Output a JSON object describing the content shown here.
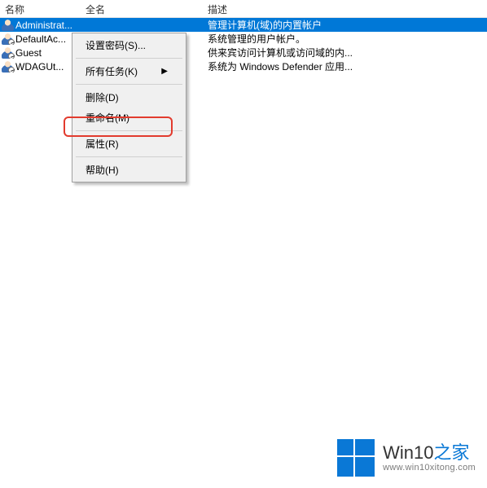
{
  "columns": {
    "name": "名称",
    "full": "全名",
    "desc": "描述"
  },
  "rows": [
    {
      "name": "Administrat...",
      "desc": "管理计算机(域)的内置帐户",
      "selected": true,
      "active": true
    },
    {
      "name": "DefaultAc...",
      "desc": "系统管理的用户帐户。"
    },
    {
      "name": "Guest",
      "desc": "供来宾访问计算机或访问域的内..."
    },
    {
      "name": "WDAGUt...",
      "desc": "系统为 Windows Defender 应用..."
    }
  ],
  "menu": {
    "set_password": "设置密码(S)...",
    "all_tasks": "所有任务(K)",
    "delete": "删除(D)",
    "rename": "重命名(M)",
    "properties": "属性(R)",
    "help": "帮助(H)"
  },
  "watermark": {
    "brand_main": "Win10",
    "brand_accent": "之家",
    "url": "www.win10xitong.com"
  }
}
